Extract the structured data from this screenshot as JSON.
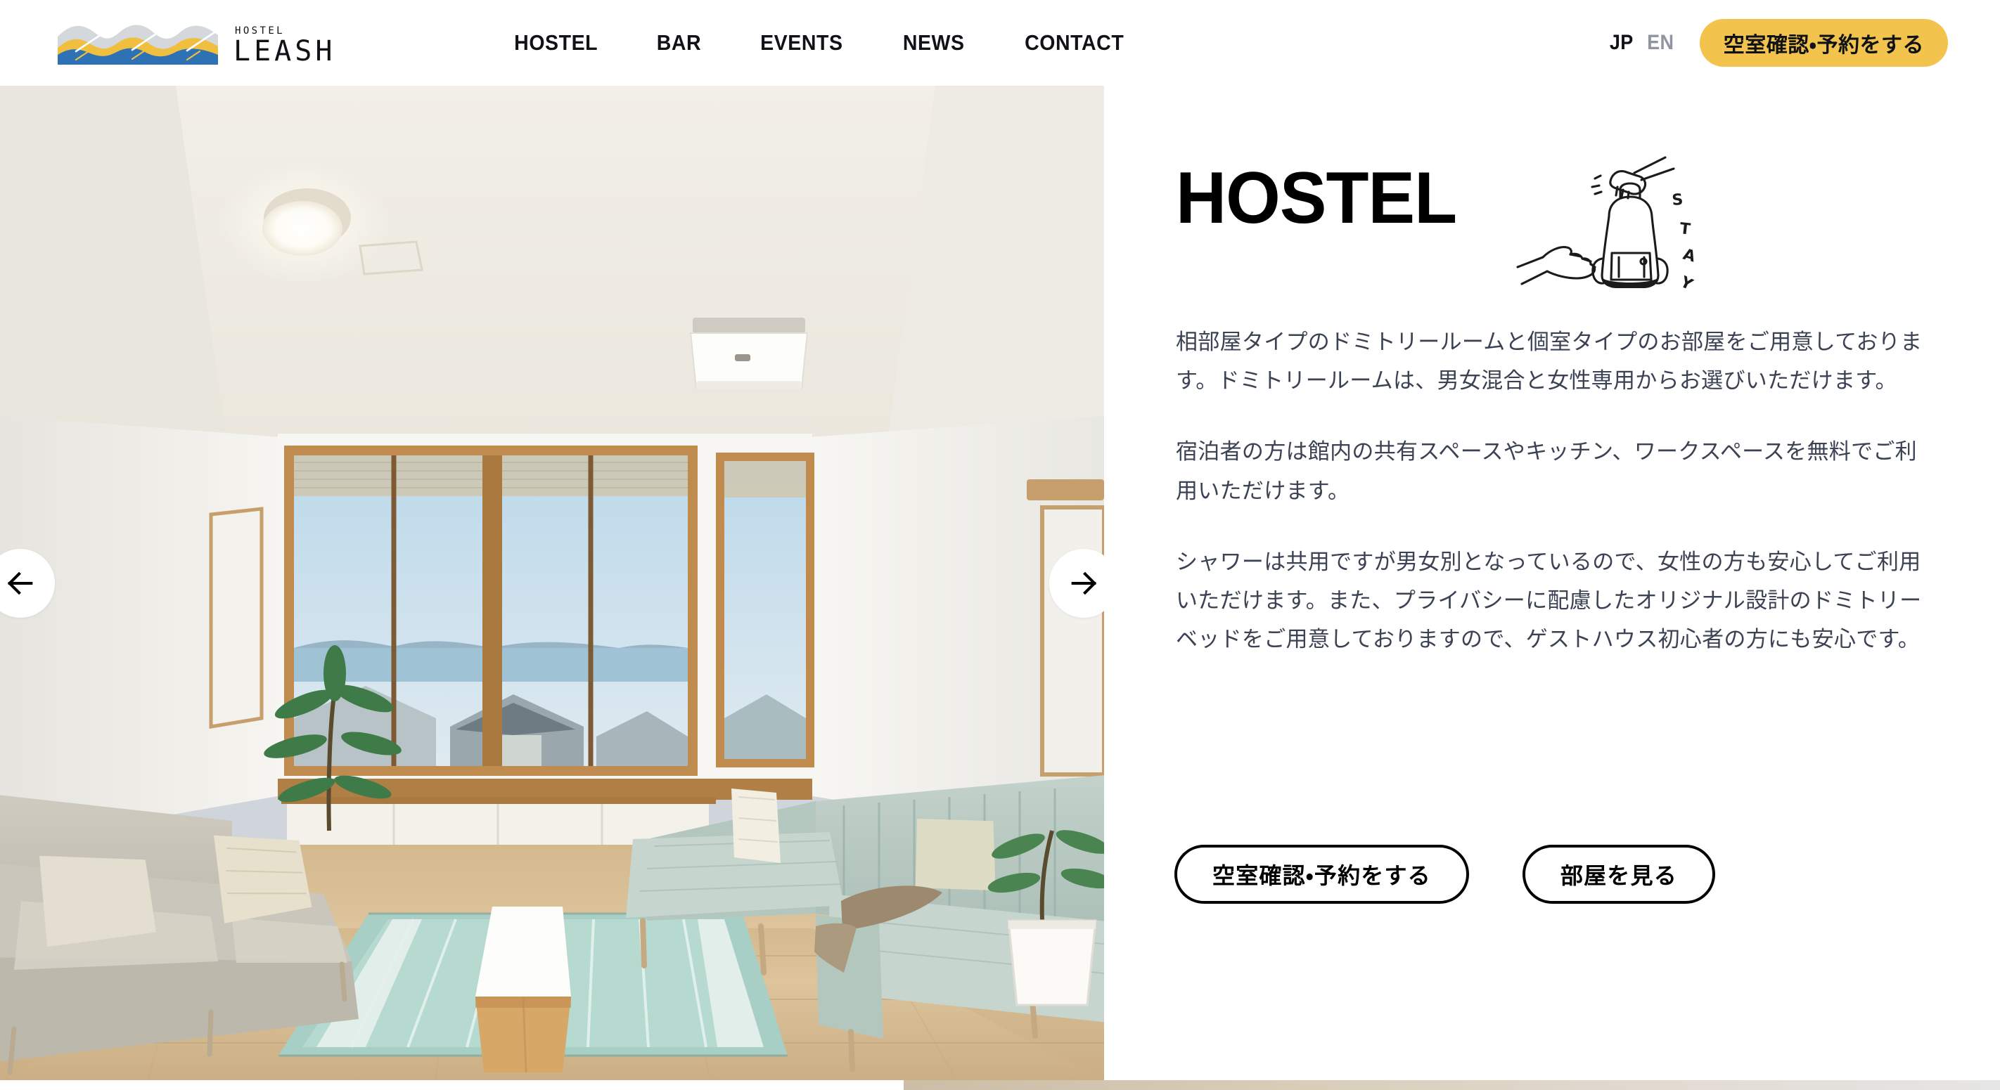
{
  "site": {
    "logo_kicker": "HOSTEL",
    "logo_name": "LEASH",
    "logo_mark_name": "wave-logo-icon"
  },
  "header": {
    "nav": [
      {
        "label": "HOSTEL",
        "name": "nav-hostel"
      },
      {
        "label": "BAR",
        "name": "nav-bar"
      },
      {
        "label": "EVENTS",
        "name": "nav-events"
      },
      {
        "label": "NEWS",
        "name": "nav-news"
      },
      {
        "label": "CONTACT",
        "name": "nav-contact"
      }
    ],
    "lang": {
      "jp": "JP",
      "en": "EN",
      "active": "JP"
    },
    "reserve_button": "空室確認・予約をする"
  },
  "hero": {
    "prev_label": "前の写真へ",
    "next_label": "次の写真へ",
    "alt": "共有ラウンジ — ソファ・ローテーブル・ラグのある明るい和モダンな部屋"
  },
  "main": {
    "title": "HOSTEL",
    "illustration_word": "STAY",
    "illustration_name": "backpack-hands-stay-illustration",
    "paragraphs": [
      "相部屋タイプのドミトリールームと個室タイプのお部屋をご用意しております。ドミトリールームは、男女混合と女性専用からお選びいただけます。",
      "宿泊者の方は館内の共有スペースやキッチン、ワークスペースを無料でご利用いただけます。",
      "シャワーは共用ですが男女別となっているので、女性の方も安心してご利用いただけます。また、プライバシーに配慮したオリジナル設計のドミトリーベッドをご用意しておりますので、ゲストハウス初心者の方にも安心です。"
    ],
    "cta": [
      {
        "label": "空室確認・予約をする",
        "name": "reserve-cta-button"
      },
      {
        "label": "部屋を見る",
        "name": "view-rooms-button"
      }
    ]
  },
  "colors": {
    "accent_yellow": "#f2c44d",
    "logo_blue": "#2e72b5",
    "logo_yellow": "#f0bf3f",
    "logo_gray": "#d4d8dc",
    "body_text": "#3b4253",
    "lang_inactive": "#8e95a1"
  }
}
